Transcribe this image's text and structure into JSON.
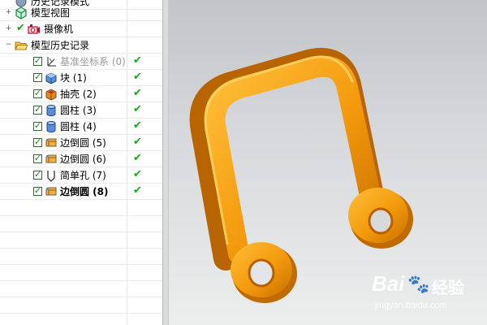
{
  "navigator": {
    "top_item": {
      "label": "历史记录模式",
      "icon": "history-icon"
    },
    "model_views": {
      "label": "模型视图",
      "icon": "model-views-icon"
    },
    "cameras": {
      "label": "摄像机",
      "icon": "camera-icon"
    },
    "model_history": {
      "label": "模型历史记录",
      "icon": "folder-open-icon"
    },
    "features": [
      {
        "label": "基准坐标系 (0)",
        "icon": "datum-csys-icon",
        "state": "suppressed-style"
      },
      {
        "label": "块 (1)",
        "icon": "block-icon"
      },
      {
        "label": "抽壳 (2)",
        "icon": "shell-icon"
      },
      {
        "label": "圆柱 (3)",
        "icon": "cylinder-icon"
      },
      {
        "label": "圆柱 (4)",
        "icon": "cylinder-icon"
      },
      {
        "label": "边倒圆 (5)",
        "icon": "edge-blend-icon"
      },
      {
        "label": "边倒圆 (6)",
        "icon": "edge-blend-icon"
      },
      {
        "label": "简单孔 (7)",
        "icon": "hole-icon"
      },
      {
        "label": "边倒圆 (8)",
        "icon": "edge-blend-icon",
        "state": "current"
      }
    ],
    "status_icon": "green-checkmark-icon"
  },
  "viewport": {
    "model": "orange-u-shaped-link-with-two-eyelets",
    "model_color": "#f49a0c",
    "background_color": "#cfd1d4"
  },
  "watermark": {
    "brand": "Bai",
    "brand_tail": "经验",
    "url": "jingyan.baidu.com"
  }
}
